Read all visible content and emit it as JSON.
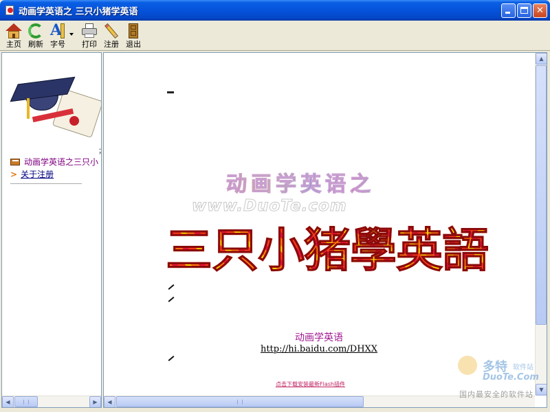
{
  "window": {
    "title": "动画学英语之  三只小猪学英语",
    "minimize_glyph": "",
    "close_glyph": "✕"
  },
  "toolbar": {
    "home": "主页",
    "refresh": "刷新",
    "font_size": "字号",
    "print": "打印",
    "register": "注册",
    "exit": "退出"
  },
  "sidebar": {
    "tick": "；",
    "items": [
      {
        "label": "动画学英语之三只小"
      },
      {
        "label": "关于注册",
        "bullet": ">"
      }
    ]
  },
  "main": {
    "subtitle": "动画学英语之",
    "watermark": "www.DuoTe.com",
    "title": "三只小猪學英語",
    "footer_title": "动画学英语",
    "footer_url": "http://hi.baidu.com/DHXX",
    "flash_link": "点击下载安装最新Flash插件"
  },
  "corner_watermark": {
    "brand": "多特",
    "brand_small": "软件站",
    "domain": "DuoTe.Com",
    "slogan": "国内最安全的软件站"
  },
  "colors": {
    "titlebar": "#0553DA",
    "chrome": "#ECE9D8",
    "link_visited": "#800080",
    "footer_title": "#A01890"
  }
}
